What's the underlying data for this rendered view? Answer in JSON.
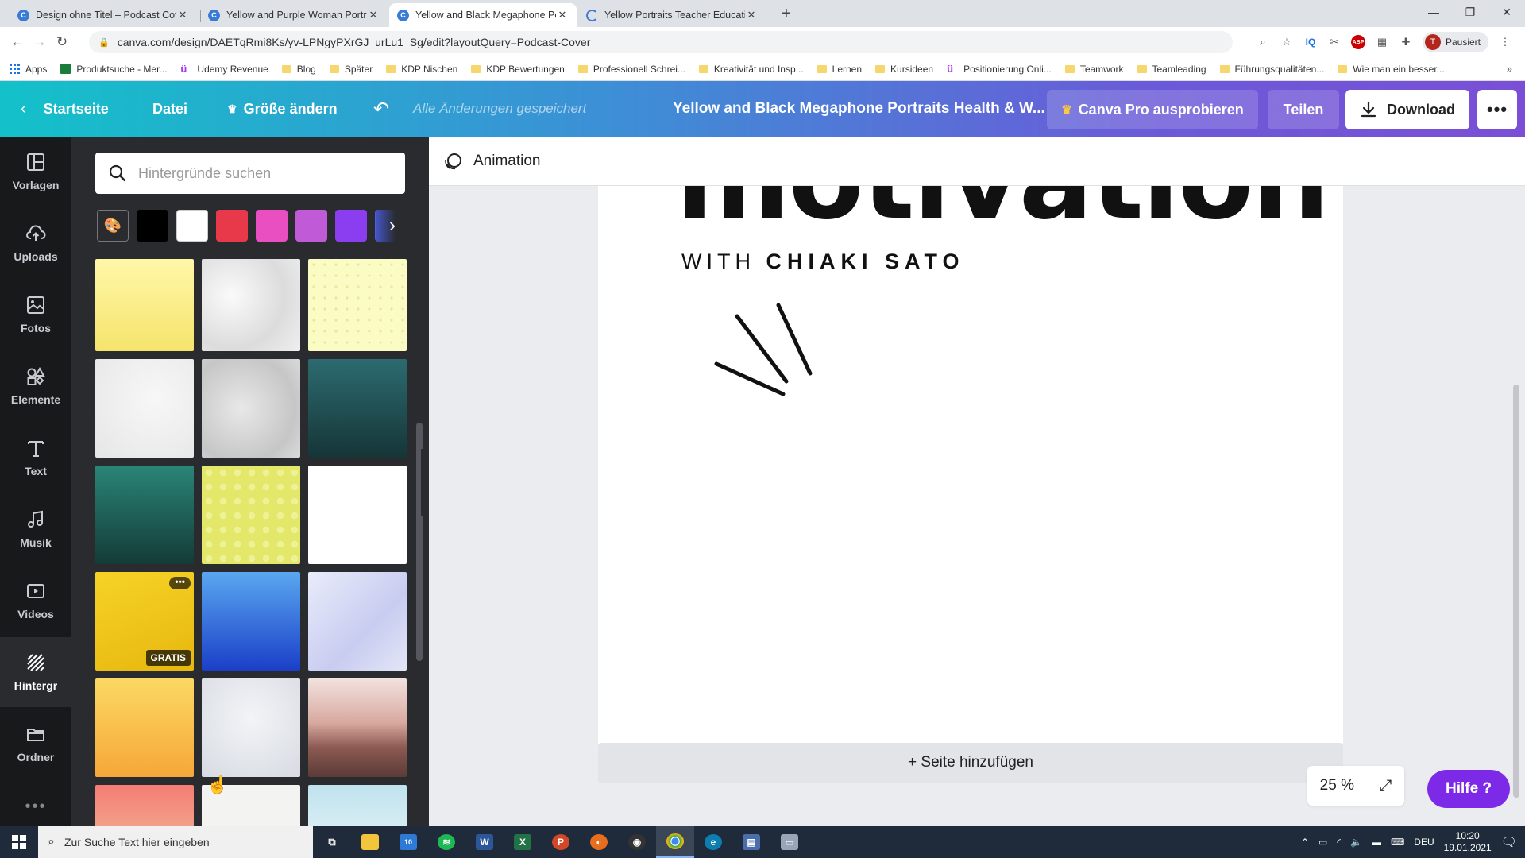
{
  "browser": {
    "tabs": [
      {
        "label": "Design ohne Titel – Podcast Cover",
        "active": false
      },
      {
        "label": "Yellow and Purple Woman Portraits",
        "active": false
      },
      {
        "label": "Yellow and Black Megaphone Portraits",
        "active": true
      },
      {
        "label": "Yellow Portraits Teacher Education",
        "active": false
      }
    ],
    "url": "canva.com/design/DAETqRmi8Ks/yv-LPNgyPXrGJ_urLu1_Sg/edit?layoutQuery=Podcast-Cover",
    "profile_label": "Pausiert",
    "profile_initial": "T",
    "ext_iq": "IQ",
    "ext_abp": "ABP",
    "bookmarks": [
      "Apps",
      "Produktsuche - Mer...",
      "Udemy Revenue",
      "Blog",
      "Später",
      "KDP Nischen",
      "KDP Bewertungen",
      "Professionell Schrei...",
      "Kreativität und Insp...",
      "Lernen",
      "Kursideen",
      "Positionierung Onli...",
      "Teamwork",
      "Teamleading",
      "Führungsqualitäten...",
      "Wie man ein besser..."
    ]
  },
  "header": {
    "home": "Startseite",
    "file": "Datei",
    "resize": "Größe ändern",
    "saved_status": "Alle Änderungen gespeichert",
    "doc_title": "Yellow and Black Megaphone Portraits Health & W...",
    "pro": "Canva Pro ausprobieren",
    "share": "Teilen",
    "download": "Download",
    "more": "•••"
  },
  "rail": [
    {
      "label": "Vorlagen",
      "icon": "templates-icon"
    },
    {
      "label": "Uploads",
      "icon": "upload-cloud-icon"
    },
    {
      "label": "Fotos",
      "icon": "photo-icon"
    },
    {
      "label": "Elemente",
      "icon": "shapes-icon"
    },
    {
      "label": "Text",
      "icon": "text-icon"
    },
    {
      "label": "Musik",
      "icon": "music-note-icon"
    },
    {
      "label": "Videos",
      "icon": "video-icon"
    },
    {
      "label": "Hintergr",
      "icon": "background-hatch-icon",
      "active": true
    },
    {
      "label": "Ordner",
      "icon": "folder-icon"
    }
  ],
  "panel": {
    "search_placeholder": "Hintergründe suchen",
    "swatches": [
      "#000000",
      "#ffffff",
      "#e8394a",
      "#e94fc0",
      "#c15ad6",
      "#8a3ef0",
      "#4a5ee8"
    ],
    "badge_free": "GRATIS",
    "tile_more": "•••"
  },
  "canvas": {
    "toolbar_animation": "Animation",
    "headline": "motivation",
    "byline_with": "WITH",
    "byline_name": "CHIAKI SATO",
    "add_page": "+ Seite hinzufügen",
    "zoom": "25 %",
    "help": "Hilfe ?"
  },
  "taskbar": {
    "search_placeholder": "Zur Suche Text hier eingeben",
    "language": "DEU",
    "time": "10:20",
    "date": "19.01.2021",
    "mail_badge": "10"
  }
}
